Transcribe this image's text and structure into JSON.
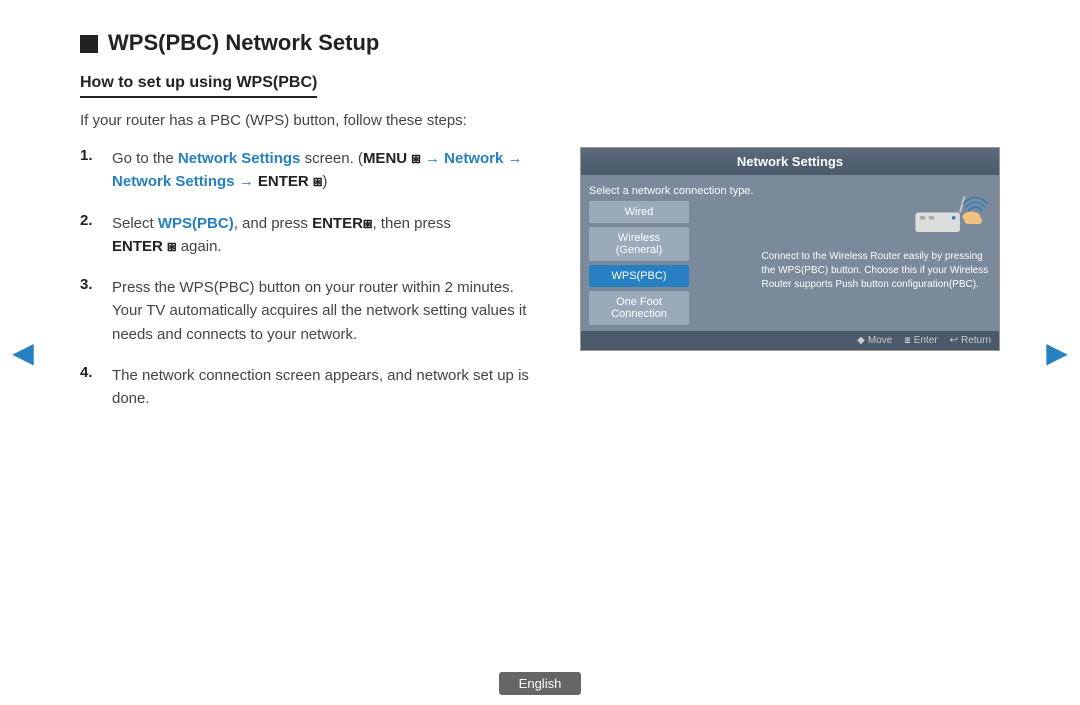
{
  "page": {
    "title": "WPS(PBC) Network Setup",
    "subtitle": "How to set up using WPS(PBC)",
    "intro": "If your router has a PBC (WPS) button, follow these steps:"
  },
  "steps": [
    {
      "number": "1.",
      "parts": [
        {
          "text": "Go to the ",
          "type": "normal"
        },
        {
          "text": "Network Settings",
          "type": "blue"
        },
        {
          "text": " screen. (",
          "type": "normal"
        },
        {
          "text": "MENU ",
          "type": "bold"
        },
        {
          "text": "→ ",
          "type": "blue"
        },
        {
          "text": "Network",
          "type": "blue"
        },
        {
          "text": " → ",
          "type": "blue"
        },
        {
          "text": "Network Settings",
          "type": "blue"
        },
        {
          "text": " → ",
          "type": "blue"
        },
        {
          "text": "ENTER ",
          "type": "bold"
        },
        {
          "text": ")",
          "type": "normal"
        }
      ]
    },
    {
      "number": "2.",
      "parts": [
        {
          "text": "Select ",
          "type": "normal"
        },
        {
          "text": "WPS(PBC)",
          "type": "blue"
        },
        {
          "text": ", and press ",
          "type": "normal"
        },
        {
          "text": "ENTER ",
          "type": "bold"
        },
        {
          "text": ", then press ",
          "type": "normal"
        },
        {
          "text": "ENTER ",
          "type": "bold"
        },
        {
          "text": "again.",
          "type": "normal"
        }
      ]
    },
    {
      "number": "3.",
      "parts": [
        {
          "text": "Press the WPS(PBC) button on your router within 2 minutes.",
          "type": "normal"
        }
      ],
      "extra": "Your TV automatically acquires all the network setting values it needs and connects to your network."
    },
    {
      "number": "4.",
      "text": "The network connection screen appears, and network set up is done."
    }
  ],
  "network_screen": {
    "title": "Network Settings",
    "select_text": "Select a network connection type.",
    "buttons": [
      {
        "label": "Wired",
        "active": false
      },
      {
        "label": "Wireless\n(General)",
        "active": false
      },
      {
        "label": "WPS(PBC)",
        "active": true
      },
      {
        "label": "One Foot\nConnection",
        "active": false
      }
    ],
    "description": "Connect to the Wireless Router easily by pressing the WPS(PBC) button. Choose this if your Wireless Router supports Push button configuration(PBC).",
    "footer": {
      "move": "Move",
      "enter": "Enter",
      "return": "Return"
    }
  },
  "nav": {
    "left_arrow": "◀",
    "right_arrow": "▶"
  },
  "footer": {
    "language": "English"
  }
}
